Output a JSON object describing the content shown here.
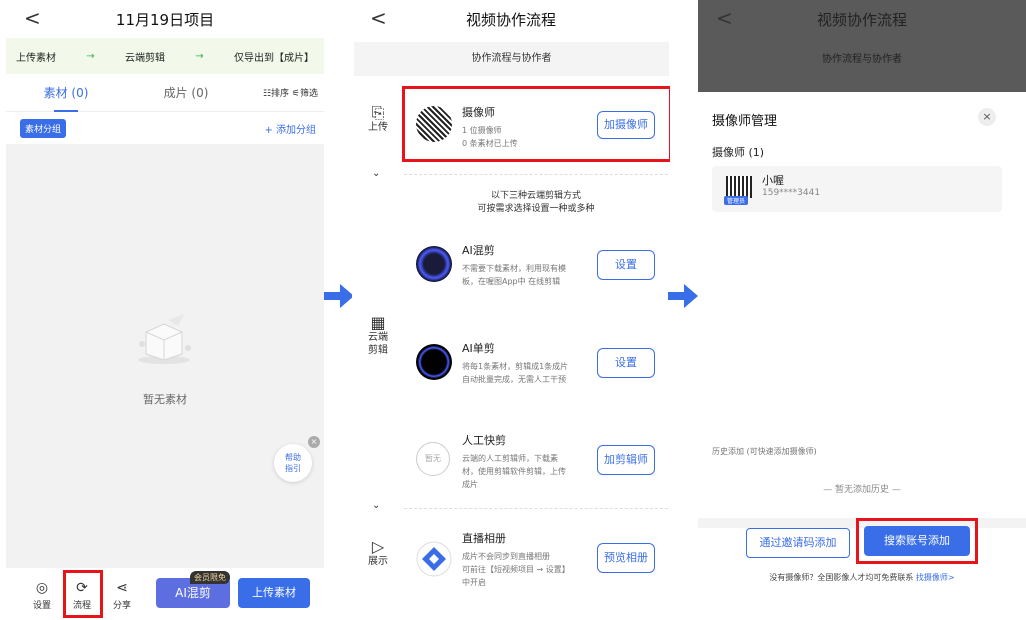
{
  "p1": {
    "title": "11月19日项目",
    "flow": [
      "上传素材",
      "→",
      "云端剪辑",
      "→",
      "仅导出到【成片】"
    ],
    "tab_material": "素材 (0)",
    "tab_film": "成片 (0)",
    "sort": "☷排序",
    "filter": "⚟筛选",
    "group_chip": "素材分组",
    "add_group": "+ 添加分组",
    "empty": "暂无素材",
    "help": [
      "帮助",
      "指引"
    ],
    "nav": {
      "settings": "设置",
      "flow": "流程",
      "share": "分享"
    },
    "vip": "会员限免",
    "ai_mix": "AI混剪",
    "upload": "上传素材"
  },
  "p2": {
    "title": "视频协作流程",
    "subhead": "协作流程与协作者",
    "side": {
      "upload": "上传",
      "cloud": [
        "云端",
        "剪辑"
      ],
      "show": "展示"
    },
    "camera": {
      "name": "摄像师",
      "count": "1 位摄像师",
      "uploaded": "0 条素材已上传",
      "btn": "加摄像师"
    },
    "intro": [
      "以下三种云端剪辑方式",
      "可按需求选择设置一种或多种"
    ],
    "ai_mix": {
      "name": "AI混剪",
      "desc": [
        "不需要下载素材，利用现有模",
        "板，在喔图App中 在线剪辑"
      ],
      "btn": "设置"
    },
    "ai_single": {
      "name": "AI单剪",
      "desc": [
        "将每1条素材，剪辑成1条成片",
        "自动批量完成，无需人工干预"
      ],
      "btn": "设置"
    },
    "manual": {
      "name": "人工快剪",
      "desc": [
        "云端的人工剪辑师，下载素",
        "材，使用剪辑软件剪辑，上传",
        "成片"
      ],
      "btn": "加剪辑师",
      "avatar": "暂无"
    },
    "live": {
      "name": "直播相册",
      "desc": [
        "成片不会同步到直播相册",
        "可前往【短视频项目 → 设置】",
        "中开启"
      ],
      "btn": "预览相册"
    }
  },
  "p3": {
    "title": "视频协作流程",
    "subhead": "协作流程与协作者",
    "sheet_title": "摄像师管理",
    "count": "摄像师 (1)",
    "person": {
      "name": "小喔",
      "phone": "159****3441",
      "badge": "管理员"
    },
    "hist": "历史添加 (可快速添加摄像师)",
    "nohist": "— 暂无添加历史 —",
    "invite": "通过邀请码添加",
    "search": "搜索账号添加",
    "foot": "没有摄像师？全国影像人才均可免费联系",
    "foot_link": "找摄像师>"
  },
  "colors": {
    "blue": "#3a6ee8",
    "red": "#e8141b",
    "green": "#36b34a"
  }
}
